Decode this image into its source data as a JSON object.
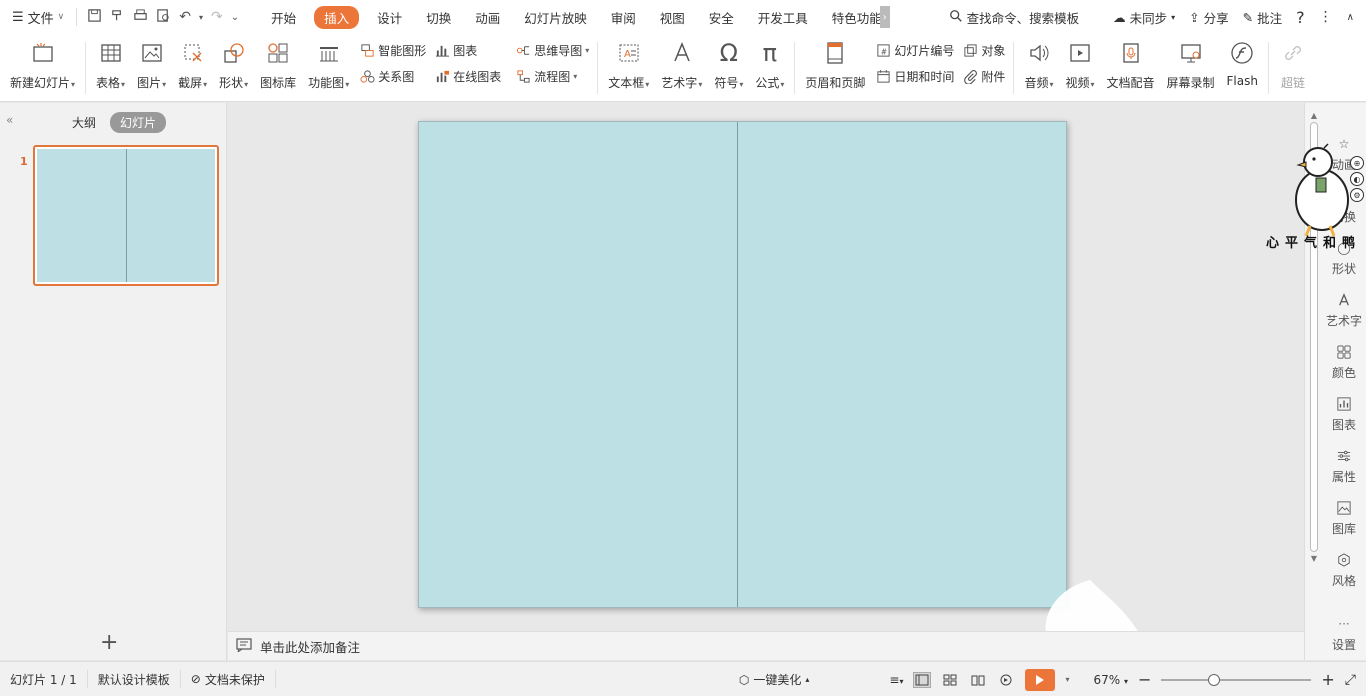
{
  "menubar": {
    "file_label": "文件",
    "tabs": [
      {
        "label": "开始",
        "active": false
      },
      {
        "label": "插入",
        "active": true
      },
      {
        "label": "设计",
        "active": false
      },
      {
        "label": "切换",
        "active": false
      },
      {
        "label": "动画",
        "active": false
      },
      {
        "label": "幻灯片放映",
        "active": false
      },
      {
        "label": "审阅",
        "active": false
      },
      {
        "label": "视图",
        "active": false
      },
      {
        "label": "安全",
        "active": false
      },
      {
        "label": "开发工具",
        "active": false
      },
      {
        "label": "特色功能",
        "active": false
      }
    ],
    "search_label": "查找命令、搜索模板",
    "sync_label": "未同步",
    "share_label": "分享",
    "comment_label": "批注",
    "help_label": "?"
  },
  "ribbon": {
    "new_slide": "新建幻灯片",
    "table": "表格",
    "picture": "图片",
    "screenshot": "截屏",
    "shape": "形状",
    "icon_lib": "图标库",
    "func_chart": "功能图",
    "smart_art": "智能图形",
    "relation": "关系图",
    "chart": "图表",
    "online_chart": "在线图表",
    "mind_map": "思维导图",
    "flowchart": "流程图",
    "textbox": "文本框",
    "wordart": "艺术字",
    "symbol": "符号",
    "formula": "公式",
    "header_footer": "页眉和页脚",
    "slide_number": "幻灯片编号",
    "date_time": "日期和时间",
    "object": "对象",
    "attachment": "附件",
    "audio": "音频",
    "video": "视频",
    "doc_dub": "文档配音",
    "screen_rec": "屏幕录制",
    "flash": "Flash",
    "hyperlink": "超链"
  },
  "leftpanel": {
    "outline_tab": "大纲",
    "slides_tab": "幻灯片",
    "slide_number": "1"
  },
  "notes": {
    "placeholder": "单击此处添加备注"
  },
  "rightbar": {
    "items": [
      {
        "label": "动画"
      },
      {
        "label": "切换"
      },
      {
        "label": "形状"
      },
      {
        "label": "艺术字"
      },
      {
        "label": "颜色"
      },
      {
        "label": "图表"
      },
      {
        "label": "属性"
      },
      {
        "label": "图库"
      },
      {
        "label": "风格"
      },
      {
        "label": "设置"
      }
    ],
    "sticker_text": "心平气和鸭"
  },
  "statusbar": {
    "slide_info": "幻灯片 1 / 1",
    "template": "默认设计模板",
    "protect": "文档未保护",
    "beautify": "一键美化",
    "zoom": "67%",
    "zoom_percent": 67
  },
  "colors": {
    "accent": "#ec7539",
    "slide_bg": "#bde0e4"
  }
}
